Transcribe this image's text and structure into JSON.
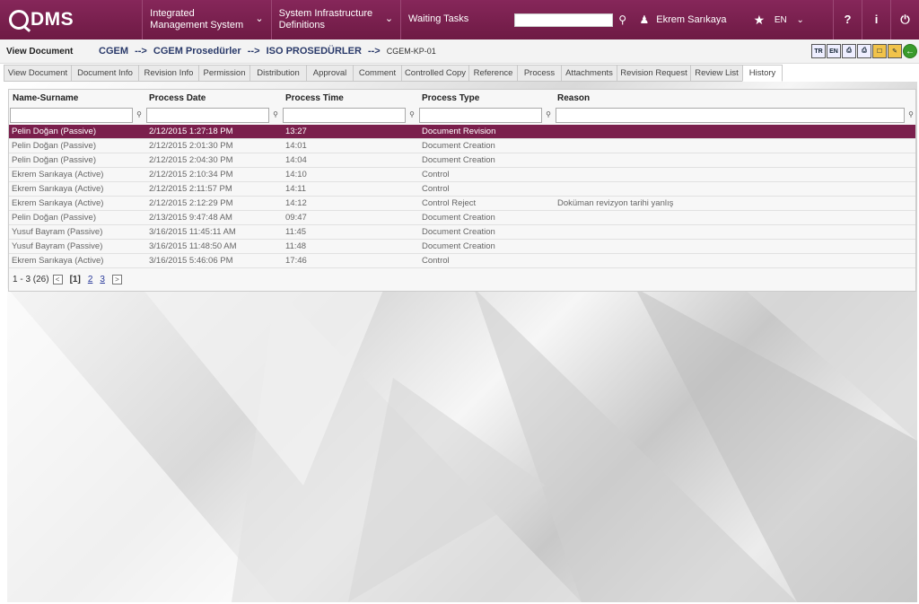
{
  "app": {
    "logo": "DMS"
  },
  "nav": {
    "item1": "Integrated Management System",
    "item2": "System Infrastructure Definitions",
    "item3": "Waiting Tasks",
    "search_placeholder": ""
  },
  "user": {
    "name": "Ekrem Sarıkaya",
    "lang": "EN"
  },
  "topicons": {
    "help": "?",
    "info": "i",
    "power": "⏻"
  },
  "breadcrumb": {
    "title": "View Document",
    "c1": "CGEM",
    "c2": "CGEM Prosedürler",
    "c3": "ISO PROSEDÜRLER",
    "c4": "CGEM-KP-01",
    "arrow": "-->"
  },
  "toolbar": {
    "tr": "TR",
    "en": "EN"
  },
  "tabs": [
    "View Document",
    "Document Info",
    "Revision Info",
    "Permission",
    "Distribution",
    "Approval",
    "Comment",
    "Controlled Copy",
    "Reference",
    "Process",
    "Attachments",
    "Revision Request",
    "Review List",
    "History"
  ],
  "grid": {
    "columns": [
      "Name-Surname",
      "Process Date",
      "Process Time",
      "Process Type",
      "Reason"
    ],
    "rows": [
      [
        "Pelin Doğan (Passive)",
        "2/12/2015 1:27:18 PM",
        "13:27",
        "Document Revision",
        ""
      ],
      [
        "Pelin Doğan (Passive)",
        "2/12/2015 2:01:30 PM",
        "14:01",
        "Document Creation",
        ""
      ],
      [
        "Pelin Doğan (Passive)",
        "2/12/2015 2:04:30 PM",
        "14:04",
        "Document Creation",
        ""
      ],
      [
        "Ekrem Sarıkaya (Active)",
        "2/12/2015 2:10:34 PM",
        "14:10",
        "Control",
        ""
      ],
      [
        "Ekrem Sarıkaya (Active)",
        "2/12/2015 2:11:57 PM",
        "14:11",
        "Control",
        ""
      ],
      [
        "Ekrem Sarıkaya (Active)",
        "2/12/2015 2:12:29 PM",
        "14:12",
        "Control Reject",
        "Doküman revizyon tarihi yanlış"
      ],
      [
        "Pelin Doğan (Passive)",
        "2/13/2015 9:47:48 AM",
        "09:47",
        "Document Creation",
        ""
      ],
      [
        "Yusuf Bayram (Passive)",
        "3/16/2015 11:45:11 AM",
        "11:45",
        "Document Creation",
        ""
      ],
      [
        "Yusuf Bayram (Passive)",
        "3/16/2015 11:48:50 AM",
        "11:48",
        "Document Creation",
        ""
      ],
      [
        "Ekrem Sarıkaya (Active)",
        "3/16/2015 5:46:06 PM",
        "17:46",
        "Control",
        ""
      ]
    ]
  },
  "pager": {
    "summary": "1 - 3 (26)",
    "current": "[1]",
    "p2": "2",
    "p3": "3"
  },
  "colors": {
    "brand": "#7a1f4c"
  }
}
